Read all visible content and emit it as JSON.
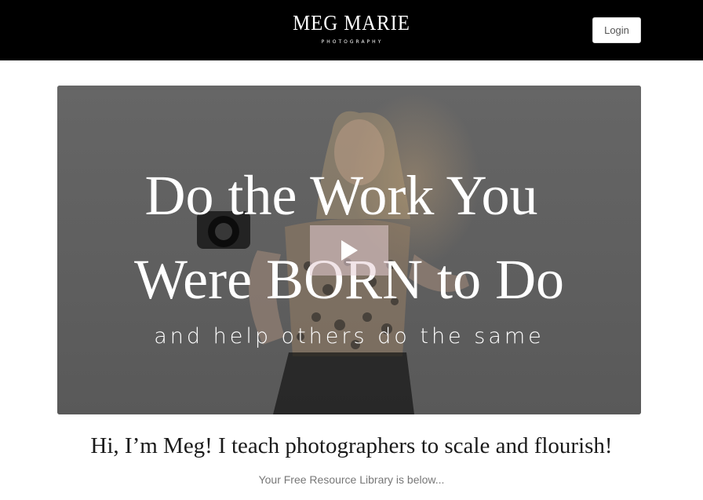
{
  "header": {
    "brand_name": "MEG MARIE",
    "brand_tagline": "PHOTOGRAPHY",
    "login_label": "Login"
  },
  "video": {
    "headline_line1": "Do the Work You",
    "headline_line2": "Were BORN to Do",
    "subline": "and help others do the same",
    "play_icon": "play-icon"
  },
  "intro": {
    "heading": "Hi, I’m Meg! I teach photographers to scale and flourish!",
    "subheading": "Your Free Resource Library is below..."
  },
  "colors": {
    "header_bg": "#000000",
    "play_button_bg": "#e6cdd4",
    "text_dark": "#1a1a1a",
    "text_muted": "#777777"
  }
}
